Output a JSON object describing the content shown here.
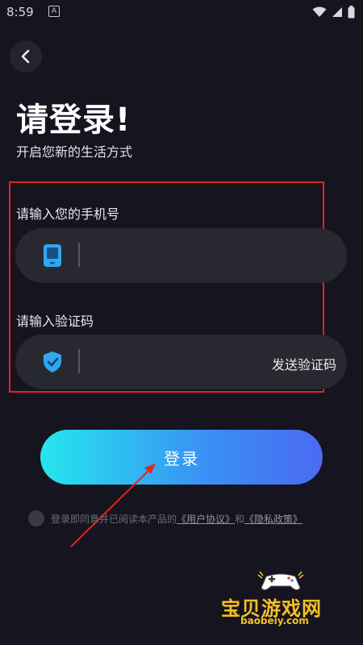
{
  "status_bar": {
    "time": "8:59",
    "notify_glyph": "A"
  },
  "page": {
    "title": "请登录!",
    "subtitle": "开启您新的生活方式"
  },
  "phone_field": {
    "label": "请输入您的手机号",
    "value": "",
    "placeholder": "",
    "icon": "phone-icon"
  },
  "code_field": {
    "label": "请输入验证码",
    "value": "",
    "placeholder": "",
    "icon": "shield-check-icon",
    "send_code_label": "发送验证码"
  },
  "login_button": {
    "label": "登录"
  },
  "agreement": {
    "prefix": "登录即同意并已阅读本产品的",
    "user_agreement": "《用户协议》",
    "conjunction": "和",
    "privacy_policy": "《隐私政策》"
  },
  "watermark": {
    "text": "宝贝游戏网",
    "url": "baobeiy.com"
  },
  "colors": {
    "background": "#15141f",
    "field_bg": "#282830",
    "gradient_start": "#25e6ee",
    "gradient_end": "#4a6af2",
    "annotation_red": "#e02525",
    "watermark_yellow": "#f6c024"
  }
}
